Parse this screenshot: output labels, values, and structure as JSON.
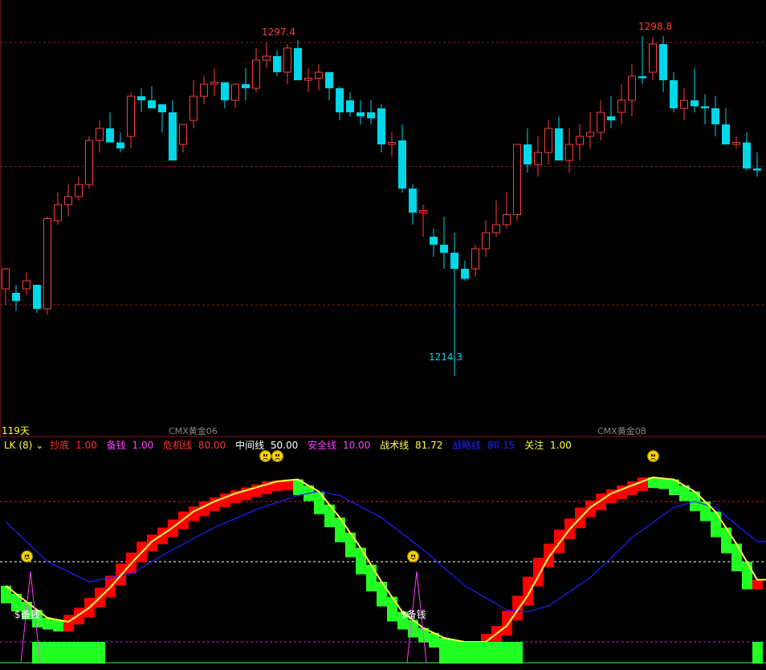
{
  "chart_data": [
    {
      "type": "candlestick",
      "title": "",
      "period_label": "119天",
      "ylim": [
        1200,
        1302
      ],
      "x_tick_labels": [
        "CMX黄金06",
        "CMX黄金08"
      ],
      "annotations": [
        {
          "text": "1297.4",
          "kind": "high"
        },
        {
          "text": "1298.8",
          "kind": "high"
        },
        {
          "text": "1214.3",
          "kind": "low"
        }
      ],
      "gridlines": [
        1297.4,
        1266.5,
        1232
      ],
      "candles": [
        [
          1236.0,
          1241.0,
          1232.0,
          1241.0
        ],
        [
          1235.0,
          1237.0,
          1230.5,
          1233.0
        ],
        [
          1236.0,
          1240.0,
          1234.5,
          1238.0
        ],
        [
          1237.0,
          1237.0,
          1230.0,
          1231.0
        ],
        [
          1231.0,
          1254.0,
          1229.5,
          1253.5
        ],
        [
          1253.0,
          1260.0,
          1252.0,
          1257.0
        ],
        [
          1257.0,
          1262.0,
          1254.0,
          1259.0
        ],
        [
          1259.0,
          1264.0,
          1258.0,
          1262.0
        ],
        [
          1262.0,
          1274.0,
          1261.0,
          1273.0
        ],
        [
          1273.0,
          1278.0,
          1270.0,
          1276.0
        ],
        [
          1276.0,
          1280.0,
          1273.0,
          1272.5
        ],
        [
          1272.5,
          1275.0,
          1270.0,
          1271.0
        ],
        [
          1274.0,
          1285.0,
          1271.0,
          1284.0
        ],
        [
          1284.0,
          1286.0,
          1280.0,
          1283.0
        ],
        [
          1283.0,
          1286.5,
          1282.0,
          1281.0
        ],
        [
          1282.0,
          1282.0,
          1275.0,
          1280.0
        ],
        [
          1280.0,
          1283.0,
          1270.0,
          1268.0
        ],
        [
          1272.0,
          1276.0,
          1270.0,
          1277.0
        ],
        [
          1278.0,
          1288.0,
          1276.0,
          1284.0
        ],
        [
          1284.0,
          1289.0,
          1282.0,
          1287.0
        ],
        [
          1287.0,
          1291.0,
          1284.0,
          1287.5
        ],
        [
          1287.5,
          1286.0,
          1281.0,
          1283.0
        ],
        [
          1283.0,
          1285.0,
          1281.0,
          1287.0
        ],
        [
          1287.0,
          1291.0,
          1283.0,
          1286.0
        ],
        [
          1286.0,
          1296.0,
          1285.0,
          1293.0
        ],
        [
          1293.0,
          1297.4,
          1291.0,
          1294.0
        ],
        [
          1294.0,
          1295.5,
          1289.0,
          1290.0
        ],
        [
          1290.0,
          1297.0,
          1287.0,
          1296.0
        ],
        [
          1296.0,
          1298.0,
          1291.0,
          1288.0
        ],
        [
          1288.0,
          1291.0,
          1285.0,
          1288.5
        ],
        [
          1288.5,
          1292.0,
          1285.5,
          1290.0
        ],
        [
          1290.0,
          1289.0,
          1283.0,
          1286.0
        ],
        [
          1286.0,
          1286.5,
          1278.0,
          1280.0
        ],
        [
          1283.0,
          1285.0,
          1279.0,
          1280.0
        ],
        [
          1280.0,
          1283.0,
          1277.0,
          1279.0
        ],
        [
          1280.0,
          1283.0,
          1277.0,
          1278.5
        ],
        [
          1281.0,
          1282.0,
          1270.0,
          1272.0
        ],
        [
          1272.0,
          1275.0,
          1269.0,
          1272.5
        ],
        [
          1273.0,
          1277.0,
          1260.0,
          1261.0
        ],
        [
          1261.0,
          1262.0,
          1252.0,
          1255.0
        ],
        [
          1255.0,
          1257.0,
          1249.0,
          1255.5
        ],
        [
          1249.0,
          1251.0,
          1244.0,
          1247.0
        ],
        [
          1247.0,
          1254.0,
          1241.0,
          1245.0
        ],
        [
          1245.0,
          1250.0,
          1214.3,
          1241.0
        ],
        [
          1241.0,
          1243.0,
          1238.0,
          1238.5
        ],
        [
          1241.0,
          1247.0,
          1239.0,
          1246.0
        ],
        [
          1246.0,
          1253.0,
          1244.0,
          1250.0
        ],
        [
          1250.0,
          1258.0,
          1249.0,
          1252.0
        ],
        [
          1252.0,
          1260.0,
          1251.0,
          1254.5
        ],
        [
          1254.5,
          1270.0,
          1253.0,
          1272.0
        ],
        [
          1272.0,
          1276.0,
          1265.0,
          1267.0
        ],
        [
          1267.0,
          1274.0,
          1264.0,
          1270.0
        ],
        [
          1270.0,
          1278.0,
          1267.0,
          1276.0
        ],
        [
          1276.0,
          1279.0,
          1269.0,
          1268.0
        ],
        [
          1268.0,
          1276.0,
          1265.0,
          1272.0
        ],
        [
          1272.0,
          1277.0,
          1268.0,
          1274.0
        ],
        [
          1274.0,
          1280.0,
          1271.0,
          1275.0
        ],
        [
          1275.0,
          1283.0,
          1273.0,
          1280.0
        ],
        [
          1279.0,
          1284.0,
          1276.0,
          1278.0
        ],
        [
          1280.0,
          1287.0,
          1277.0,
          1283.0
        ],
        [
          1283.0,
          1292.0,
          1279.0,
          1289.0
        ],
        [
          1289.0,
          1299.0,
          1287.0,
          1288.5
        ],
        [
          1290.0,
          1298.8,
          1288.0,
          1297.0
        ],
        [
          1297.0,
          1299.0,
          1285.0,
          1288.0
        ],
        [
          1288.0,
          1290.0,
          1280.0,
          1281.0
        ],
        [
          1281.0,
          1286.0,
          1278.0,
          1283.0
        ],
        [
          1283.0,
          1291.0,
          1280.0,
          1281.5
        ],
        [
          1281.5,
          1284.5,
          1277.0,
          1281.0
        ],
        [
          1281.0,
          1284.0,
          1274.0,
          1277.0
        ],
        [
          1277.0,
          1281.0,
          1273.0,
          1272.0
        ],
        [
          1272.0,
          1274.0,
          1271.0,
          1272.5
        ],
        [
          1272.5,
          1275.0,
          1265.5,
          1266.0
        ],
        [
          1266.0,
          1270.0,
          1264.0,
          1265.5
        ]
      ],
      "colors": {
        "up": "#ff3c3c",
        "down": "#00d7e8",
        "grid": "#8a1a1a"
      }
    },
    {
      "type": "line",
      "title": "LK (8)",
      "ylim": [
        0,
        100
      ],
      "legend": [
        {
          "name": "抄底",
          "value": "1.00",
          "color": "#ff3333"
        },
        {
          "name": "备钱",
          "value": "1.00",
          "color": "#ff40ff"
        },
        {
          "name": "危机线",
          "value": "80.00",
          "color": "#ff3333"
        },
        {
          "name": "中间线",
          "value": "50.00",
          "color": "#ffffff"
        },
        {
          "name": "安全线",
          "value": "10.00",
          "color": "#ff40ff"
        },
        {
          "name": "战术线",
          "value": "81.72",
          "color": "#ffff40"
        },
        {
          "name": "战略线",
          "value": "80.15",
          "color": "#2020ff"
        },
        {
          "name": "关注",
          "value": "1.00",
          "color": "#ffff40"
        }
      ],
      "reference_lines": [
        80,
        50,
        10
      ],
      "tactic_line": [
        [
          0,
          38
        ],
        [
          2,
          30
        ],
        [
          4,
          22
        ],
        [
          6,
          20
        ],
        [
          8,
          27
        ],
        [
          10,
          37
        ],
        [
          12,
          49
        ],
        [
          14,
          60
        ],
        [
          16,
          67
        ],
        [
          18,
          75
        ],
        [
          20,
          80
        ],
        [
          22,
          84
        ],
        [
          24,
          87
        ],
        [
          26,
          90
        ],
        [
          28,
          91
        ],
        [
          30,
          85
        ],
        [
          32,
          72
        ],
        [
          34,
          57
        ],
        [
          36,
          40
        ],
        [
          38,
          25
        ],
        [
          40,
          17
        ],
        [
          42,
          12
        ],
        [
          44,
          10
        ],
        [
          46,
          10
        ],
        [
          48,
          18
        ],
        [
          50,
          33
        ],
        [
          52,
          52
        ],
        [
          54,
          66
        ],
        [
          56,
          77
        ],
        [
          58,
          84
        ],
        [
          60,
          88
        ],
        [
          62,
          92
        ],
        [
          64,
          91
        ],
        [
          66,
          85
        ],
        [
          68,
          75
        ],
        [
          70,
          59
        ],
        [
          72,
          41
        ]
      ],
      "strategy_line": [
        [
          0,
          70
        ],
        [
          4,
          50
        ],
        [
          8,
          40
        ],
        [
          12,
          44
        ],
        [
          16,
          56
        ],
        [
          20,
          67
        ],
        [
          24,
          76
        ],
        [
          28,
          83
        ],
        [
          30,
          85
        ],
        [
          32,
          83
        ],
        [
          36,
          72
        ],
        [
          40,
          56
        ],
        [
          44,
          38
        ],
        [
          48,
          26
        ],
        [
          50,
          25
        ],
        [
          52,
          28
        ],
        [
          56,
          42
        ],
        [
          60,
          62
        ],
        [
          64,
          77
        ],
        [
          66,
          80
        ],
        [
          68,
          77
        ],
        [
          72,
          60
        ]
      ],
      "signals": [
        {
          "text": "$备钱",
          "bar": 2
        },
        {
          "text": "$备钱",
          "bar": 39
        }
      ],
      "face_markers": [
        {
          "kind": "happy",
          "bar": 2,
          "level": 50
        },
        {
          "kind": "sad",
          "bar": 25,
          "level": 96
        },
        {
          "kind": "sad",
          "bar": 26,
          "level": 96
        },
        {
          "kind": "happy",
          "bar": 39,
          "level": 50
        },
        {
          "kind": "sad",
          "bar": 62,
          "level": 96
        }
      ],
      "attention_blocks": [
        {
          "from": 3,
          "to": 9
        },
        {
          "from": 42,
          "to": 49
        },
        {
          "from": 72,
          "to": 72
        }
      ],
      "colors": {
        "rise": "#ff0000",
        "fall": "#22ff22",
        "attention": "#22ff22"
      }
    }
  ]
}
